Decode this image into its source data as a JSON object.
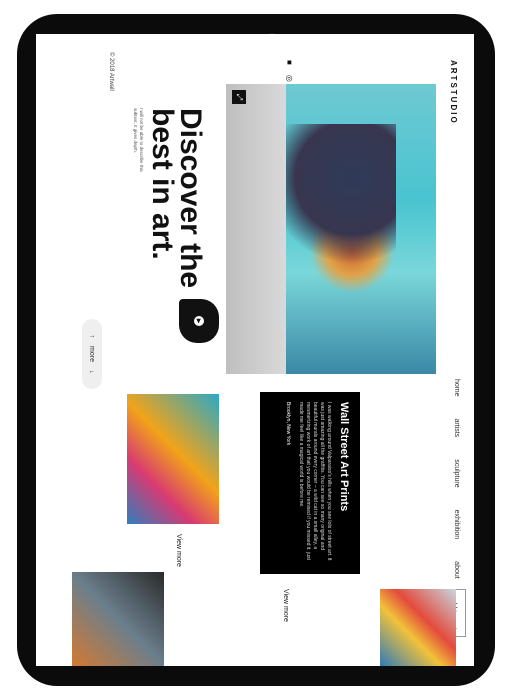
{
  "brand": "ARTSTUDIO",
  "nav": [
    "home",
    "artists",
    "sculpture",
    "exhibition",
    "about"
  ],
  "cart": "add to cart",
  "social_icons": [
    "facebook-icon",
    "instagram-icon",
    "twitter-icon"
  ],
  "copyright": "© 2018 Artwall",
  "hero": {
    "headline": "Discover the\nbest in art.",
    "subtext": "I will not be able to describe this subtext. It gives depth."
  },
  "more": "more",
  "card1": {
    "view": "View more"
  },
  "card2": {
    "title": "Wall Street Art Prints",
    "body": "I was walking around Valparaiso's hills when you see lots of street art. It was just amazing all the graffitis. You can see so many original and beautiful murals around every corner – a wild cat in a small alley, a mesmerizing work of art that you would be remised if you missed it. just made me feel like a magical world is before me.",
    "location": "Brooklyn, New York",
    "view": "View more"
  }
}
